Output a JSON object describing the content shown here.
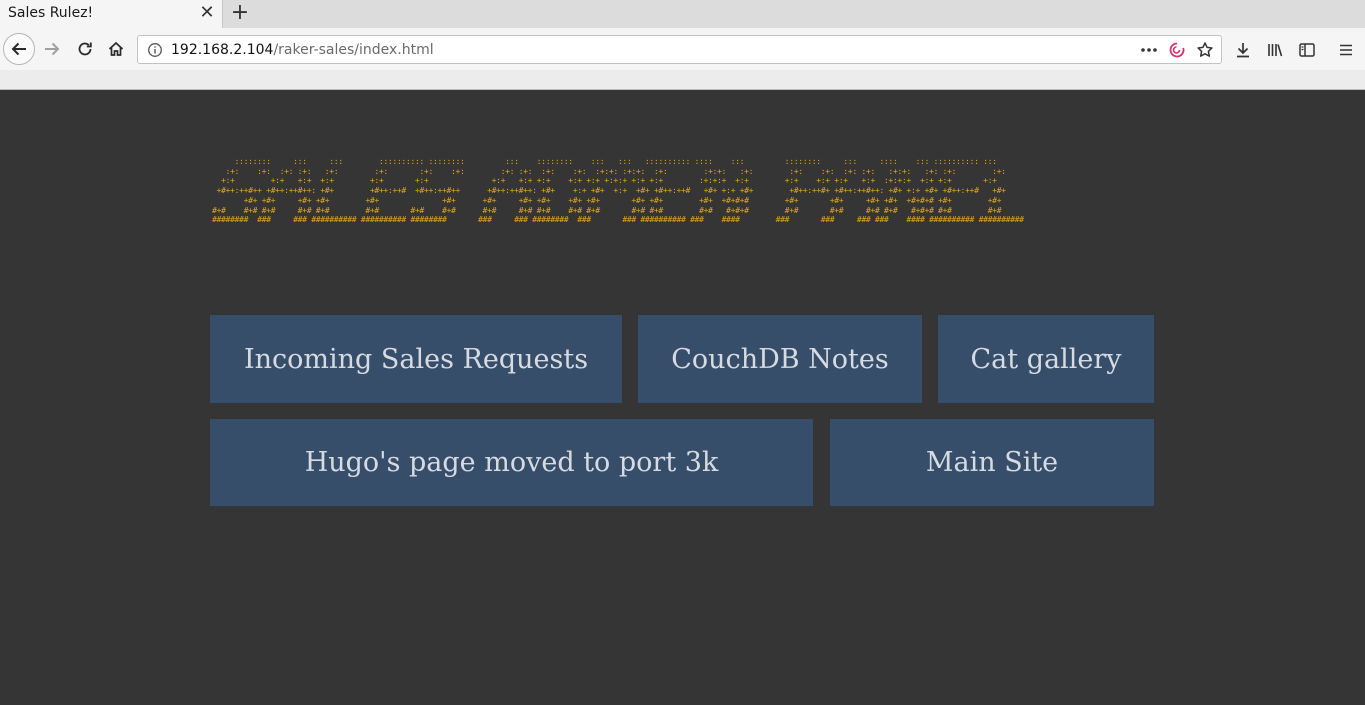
{
  "browser": {
    "tab": {
      "title": "Sales Rulez!"
    },
    "url": {
      "host": "192.168.2.104",
      "path": "/raker-sales/index.html"
    }
  },
  "page": {
    "banner_ascii": "     ::::::::     :::     :::        :::::::::: ::::::::         :::    ::::::::    :::   :::   :::::::::: ::::    :::         ::::::::     :::     ::::    ::: :::::::::: :::\n   :+:    :+:  :+: :+:   :+:        :+:       :+:    :+:        :+: :+:  :+:    :+:  :+:+: :+:+:  :+:        :+:+:   :+:        :+:    :+:  :+: :+:   :+:+:   :+: :+:        :+:\n  +:+        +:+   +:+  +:+        +:+       +:+              +:+   +:+ +:+    +:+ +:+ +:+:+ +:+ +:+        :+:+:+  +:+        +:+    +:+ +:+   +:+  :+:+:+  +:+ +:+       +:+\n +#++:++#++ +#++:++#++: +#+        +#++:++#  +#++:++#++      +#++:++#++: +#+    +:+ +#+  +:+  +#+ +#++:++#   +#+ +:+ +#+        +#++:++#+ +#++:++#++: +#+ +:+ +#+ +#++:++#   +#+\n       +#+ +#+     +#+ +#+        +#+              +#+      +#+     +#+ +#+    +#+ +#+       +#+ +#+        +#+  +#+#+#        +#+       +#+     +#+ +#+  +#+#+# +#+        +#+\n#+#    #+# #+#     #+# #+#        #+#       #+#    #+#      #+#     #+# #+#    #+# #+#       #+# #+#        #+#   #+#+#        #+#       #+#     #+# #+#   #+#+# #+#        #+#\n########  ###     ### ########## ########## ########       ###     ### ########  ###       ### ########## ###    ####        ###       ###     ### ###    #### ########## ##########",
    "buttons": {
      "incoming": "Incoming Sales Requests",
      "couchdb": "CouchDB Notes",
      "cat": "Cat gallery",
      "hugo": "Hugo's page moved to port 3k",
      "main": "Main Site"
    }
  },
  "icons": {
    "back": "back-arrow-icon",
    "forward": "forward-arrow-icon",
    "reload": "reload-icon",
    "home": "home-icon",
    "info": "info-icon",
    "more": "more-actions-icon",
    "pocket": "pocket-icon",
    "bookmark": "bookmark-star-icon",
    "download": "download-icon",
    "library": "library-icon",
    "sidebar": "sidebar-icon",
    "menu": "hamburger-menu-icon"
  },
  "colors": {
    "page_bg": "#353535",
    "button_bg": "#374e6b",
    "button_text": "#d7dbe1",
    "banner_text": "#e0a71c"
  }
}
